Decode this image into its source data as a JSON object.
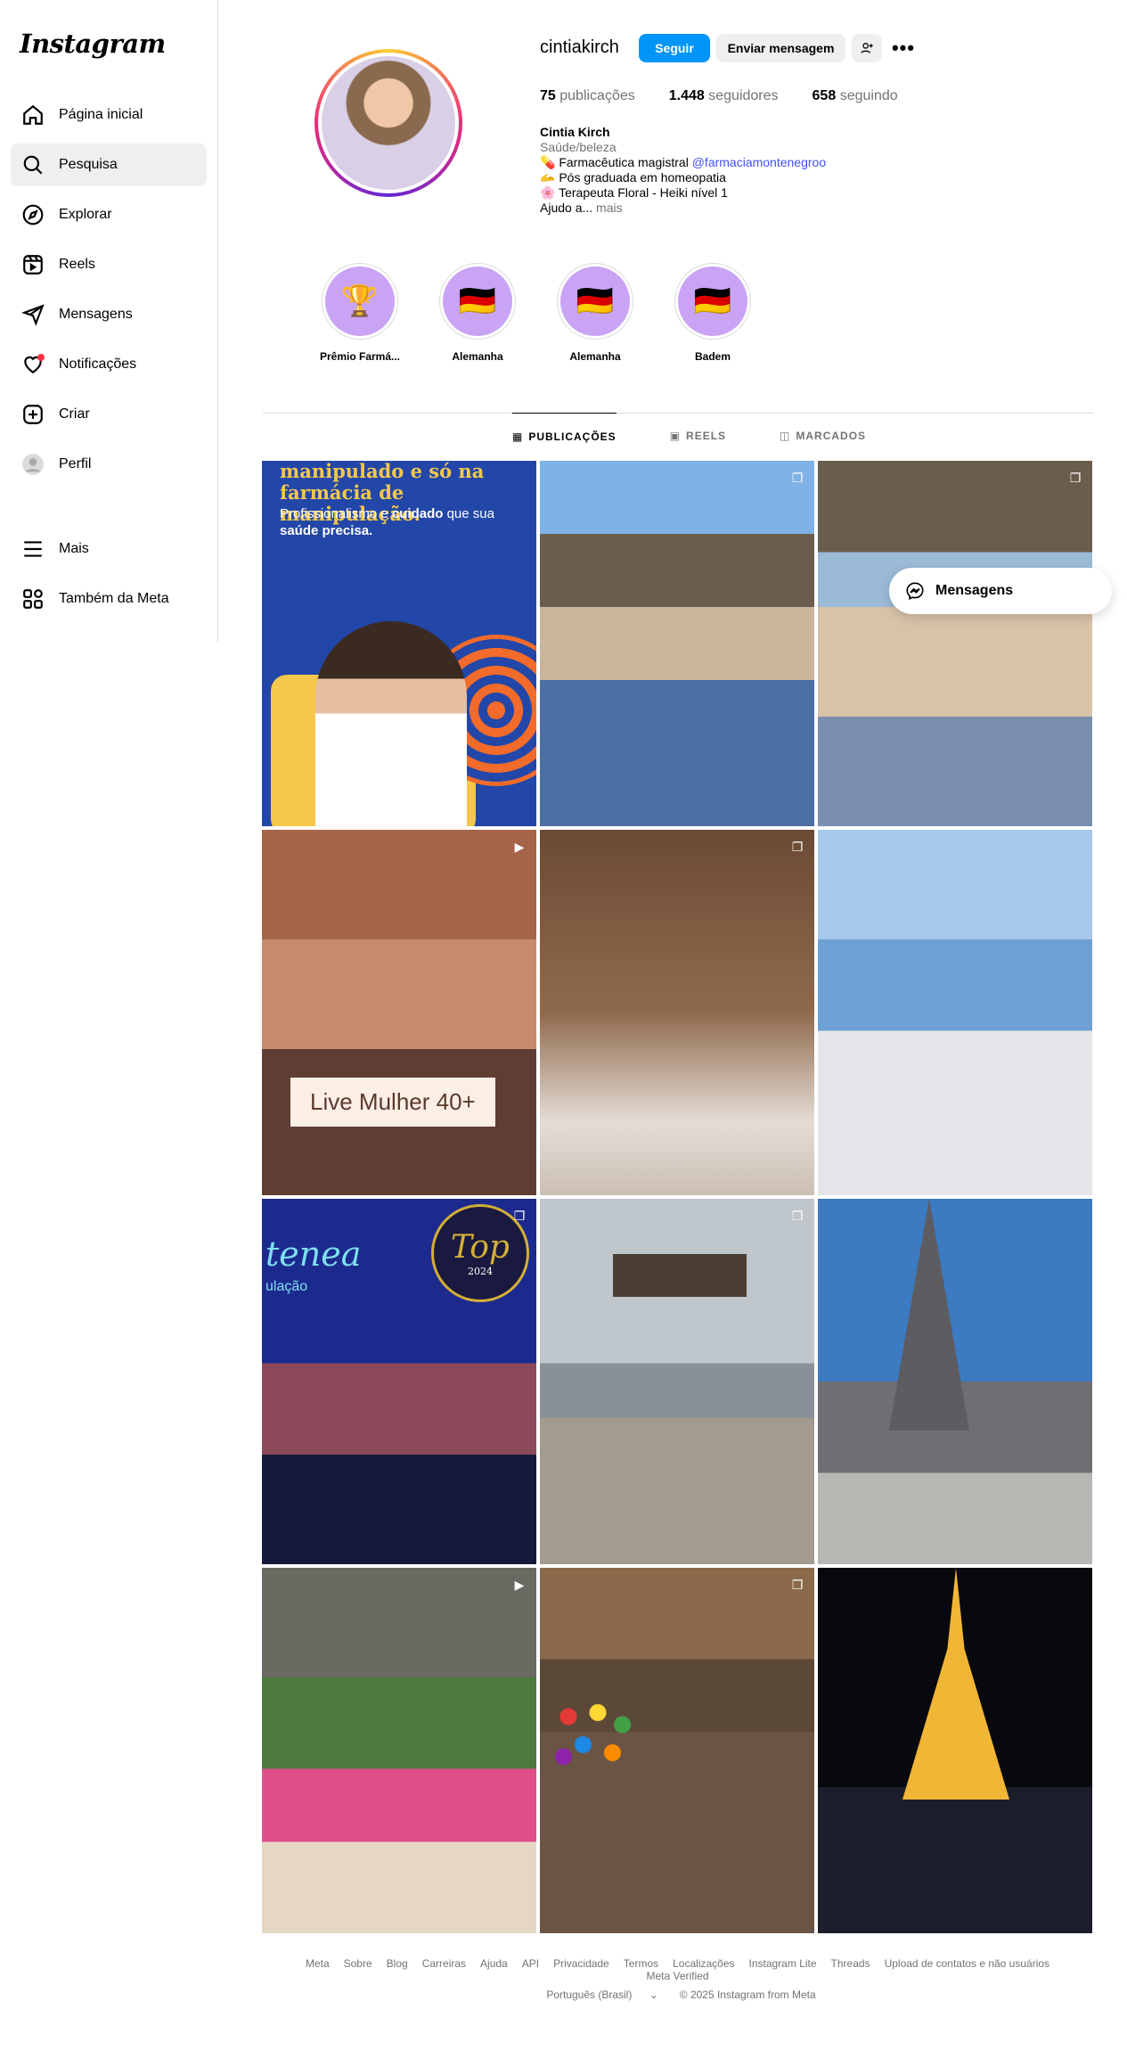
{
  "brand": "Instagram",
  "sidebar": {
    "items": [
      {
        "label": "Página inicial",
        "icon": "home-icon"
      },
      {
        "label": "Pesquisa",
        "icon": "search-icon",
        "active": true
      },
      {
        "label": "Explorar",
        "icon": "compass-icon"
      },
      {
        "label": "Reels",
        "icon": "reels-icon"
      },
      {
        "label": "Mensagens",
        "icon": "send-icon"
      },
      {
        "label": "Notificações",
        "icon": "heart-icon"
      },
      {
        "label": "Criar",
        "icon": "plus-square-icon"
      },
      {
        "label": "Perfil",
        "icon": "profile-avatar-icon"
      }
    ],
    "bottom": [
      {
        "label": "Mais",
        "icon": "menu-icon"
      },
      {
        "label": "Também da Meta",
        "icon": "meta-apps-icon"
      }
    ]
  },
  "profile": {
    "username": "cintiakirch",
    "follow_label": "Seguir",
    "message_label": "Enviar mensagem",
    "more_glyph": "•••",
    "stats": {
      "posts_count": "75",
      "posts_label": "publicações",
      "followers_count": "1.448",
      "followers_label": "seguidores",
      "following_count": "658",
      "following_label": "seguindo"
    },
    "bio": {
      "name": "Cintia Kirch",
      "category": "Saúde/beleza",
      "line1_emoji": "💊",
      "line1_text": "Farmacêutica magistral",
      "line1_mention": "@farmaciamontenegroo",
      "line2_emoji": "🫴",
      "line2_text": "Pós graduada em homeopatia",
      "line3_emoji": "🌸",
      "line3_text": "Terapeuta Floral - Heiki nível 1",
      "line4_text": "Ajudo a...",
      "more_label": "mais"
    }
  },
  "highlights": [
    {
      "label": "Prêmio Farmá...",
      "emoji": "🏆"
    },
    {
      "label": "Alemanha",
      "emoji": "🇩🇪"
    },
    {
      "label": "Alemanha",
      "emoji": "🇩🇪"
    },
    {
      "label": "Badem",
      "emoji": "🇩🇪"
    }
  ],
  "tabs": [
    {
      "label": "PUBLICAÇÕES",
      "icon": "grid-icon",
      "glyph": "▦",
      "active": true
    },
    {
      "label": "REELS",
      "icon": "reels-icon",
      "glyph": "▣",
      "active": false
    },
    {
      "label": "MARCADOS",
      "icon": "tagged-icon",
      "glyph": "◫",
      "active": false
    }
  ],
  "posts": {
    "p1_heading": "manipulado e só na\nfarmácia de manipulação.",
    "p1_text_a": "Profissionalismo e ",
    "p1_text_bold": "cuidado",
    "p1_text_b": " que sua ",
    "p1_text_bold2": "saúde precisa.",
    "p4_caption": "Live Mulher 40+",
    "p7_top": "Top",
    "p7_year": "2024",
    "p7_brand": "tenea",
    "p7_brand2": "ulação"
  },
  "floating": {
    "messages_label": "Mensagens"
  },
  "footer": {
    "links": [
      "Meta",
      "Sobre",
      "Blog",
      "Carreiras",
      "Ajuda",
      "API",
      "Privacidade",
      "Termos",
      "Localizações",
      "Instagram Lite",
      "Threads",
      "Upload de contatos e não usuários",
      "Meta Verified"
    ],
    "language": "Português (Brasil)",
    "copyright": "© 2025 Instagram from Meta"
  }
}
